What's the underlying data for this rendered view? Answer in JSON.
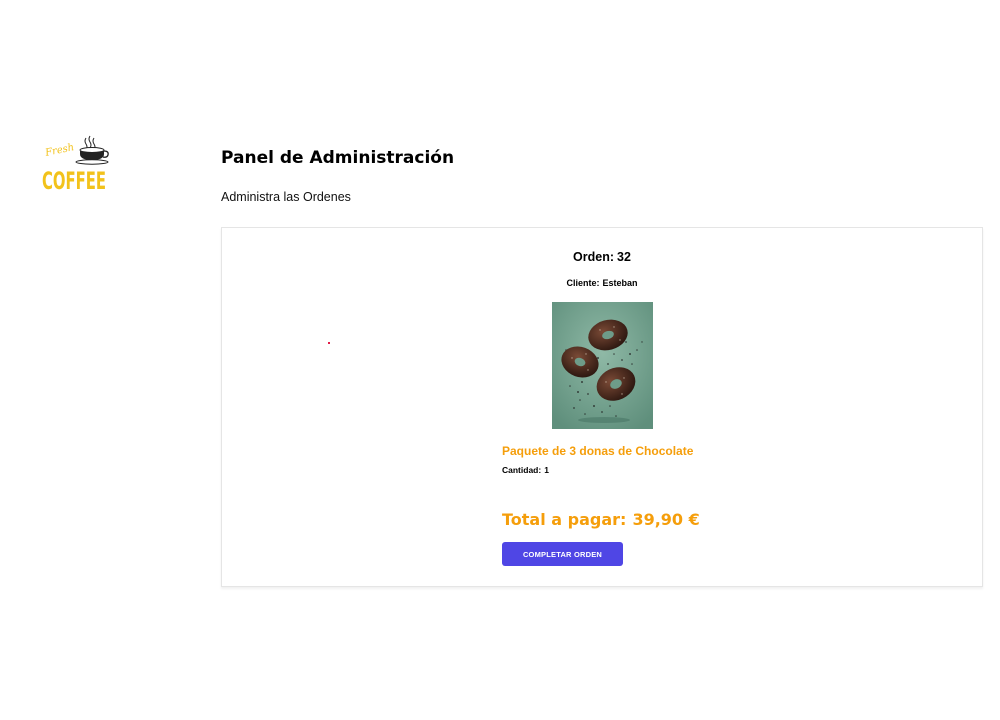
{
  "brand": {
    "logo_text": "COFFEE",
    "logo_script": "Fresh"
  },
  "header": {
    "title": "Panel de Administración",
    "subtitle": "Administra las Ordenes"
  },
  "order": {
    "number_label": "Orden:",
    "number": "32",
    "client_label": "Cliente:",
    "client": "Esteban",
    "product_name": "Paquete de 3 donas de Chocolate",
    "quantity_label": "Cantidad:",
    "quantity": "1",
    "total_label": "Total a pagar:",
    "total": "39,90 €",
    "complete_button": "COMPLETAR ORDEN"
  },
  "colors": {
    "accent": "#f59e0b",
    "button": "#4f46e5",
    "logo_yellow": "#f2c21b"
  }
}
